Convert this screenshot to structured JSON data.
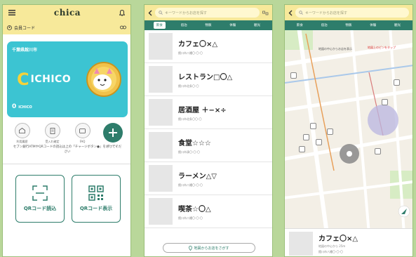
{
  "wallet": {
    "logo": "chica",
    "member_code_label": "会員コード",
    "card_city": "千葉県館川市",
    "card_brand_c": "C",
    "card_brand_text": "ICHICO",
    "balance": "0",
    "balance_unit": "ICHICO",
    "actions": [
      {
        "label": "利用履歴",
        "icon": "wallet-icon"
      },
      {
        "label": "受入れ確定",
        "icon": "receipt-icon"
      },
      {
        "label": "FAQ",
        "icon": "faq-icon"
      },
      {
        "label": "チャージ",
        "icon": "plus-icon"
      }
    ],
    "note": "セブン銀行ATMやQRコードの読込は上の「チャージボタン●」をおしてください",
    "qr_read": "QRコード読込",
    "qr_show": "QRコード表示"
  },
  "list": {
    "search_placeholder": "キーワードからお店を探す",
    "categories": [
      "飲食",
      "宿泊",
      "物販",
      "体験",
      "観光"
    ],
    "shops": [
      {
        "name": "カフェ〇×△",
        "addr": "館川市八幡〇-〇-〇"
      },
      {
        "name": "レストラン□〇△",
        "addr": "館川市北条〇-〇"
      },
      {
        "name": "居酒屋 ＋−×÷",
        "addr": "館川市北条〇〇-〇"
      },
      {
        "name": "食堂☆☆☆",
        "addr": "館川市湊〇-〇-〇"
      },
      {
        "name": "ラーメン△▽",
        "addr": "館川市八幡〇-〇-〇"
      },
      {
        "name": "喫茶☆〇△",
        "addr": "館川市八幡〇-〇-〇"
      }
    ],
    "map_button": "地図からお店をさがす"
  },
  "map": {
    "search_placeholder": "キーワードからお店を探す",
    "categories": [
      "飲食",
      "宿泊",
      "物販",
      "体験",
      "観光"
    ],
    "map_label_1": "地図の中心からお店を表示",
    "map_label_2": "地図上のピンをタップ",
    "selected": {
      "name": "カフェ〇×△",
      "distance": "地図の中心から 25m",
      "addr": "館川市八幡〇-〇-〇"
    }
  },
  "colors": {
    "header": "#f7e99a",
    "accent": "#2e7d6b",
    "card": "#3cc4d2",
    "background": "#b9d79a"
  }
}
